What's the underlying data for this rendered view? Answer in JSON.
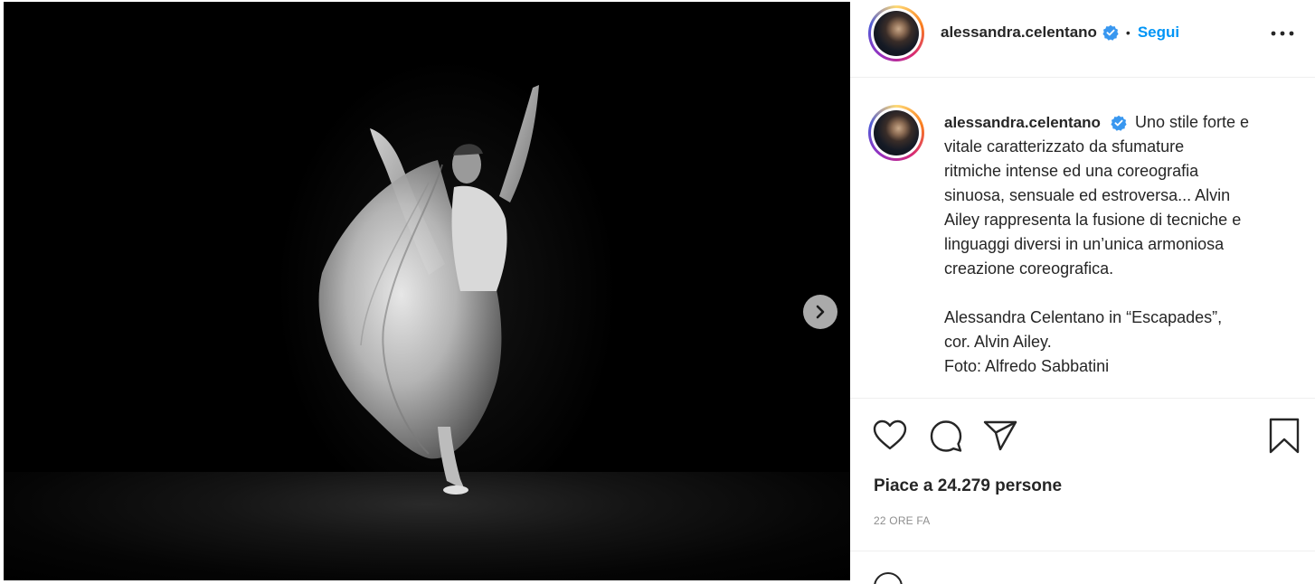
{
  "post": {
    "media": {
      "alt_icon": "photo-dancer",
      "next_icon": "chevron-right-icon"
    },
    "header": {
      "username": "alessandra.celentano",
      "separator": "•",
      "follow_label": "Segui",
      "more_icon": "more-horizontal-icon"
    },
    "caption": {
      "username": "alessandra.celentano",
      "lines": [
        "Uno stile forte e",
        "vitale caratterizzato da sfumature",
        "ritmiche intense ed una coreografia",
        "sinuosa, sensuale ed estroversa... Alvin",
        "Ailey rappresenta la fusione di tecniche e",
        "linguaggi diversi in un’unica armoniosa",
        "creazione coreografica.",
        "",
        "Alessandra Celentano in “Escapades”,",
        "cor. Alvin Ailey.",
        "Foto: Alfredo Sabbatini"
      ]
    },
    "actions": {
      "like_icon": "heart-icon",
      "comment_icon": "comment-icon",
      "share_icon": "paper-plane-icon",
      "save_icon": "bookmark-icon"
    },
    "likes_text": "Piace a 24.279 persone",
    "timestamp": "22 ORE FA",
    "colors": {
      "accent": "#0095f6",
      "text": "#262626",
      "muted": "#8e8e8e",
      "verified": "#3897f0"
    }
  }
}
